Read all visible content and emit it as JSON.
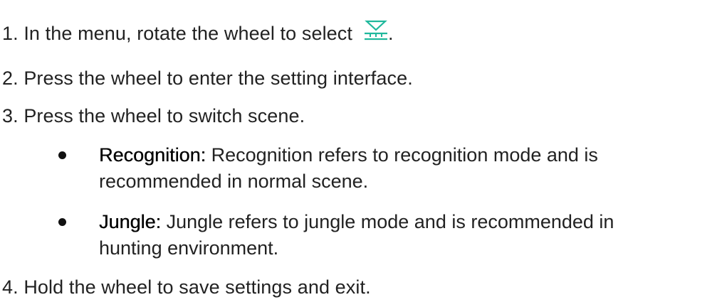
{
  "steps": [
    {
      "text": "1. In the menu, rotate the wheel to select",
      "suffix": ".",
      "icon": "scene-mode-icon"
    },
    {
      "text": "2. Press the wheel to enter the setting interface."
    },
    {
      "text": "3. Press the wheel to switch scene."
    },
    {
      "text": "4. Hold the wheel to save settings and exit."
    }
  ],
  "bullets": [
    {
      "term": "Recognition:",
      "line1": " Recognition refers to recognition mode and is",
      "line2": "recommended in normal scene."
    },
    {
      "term": "Jungle:",
      "line1": " Jungle refers to jungle mode and is recommended in",
      "line2": "hunting environment."
    }
  ],
  "colors": {
    "text": "#222222",
    "icon": "#1fb89c",
    "bullet": "#111111"
  }
}
